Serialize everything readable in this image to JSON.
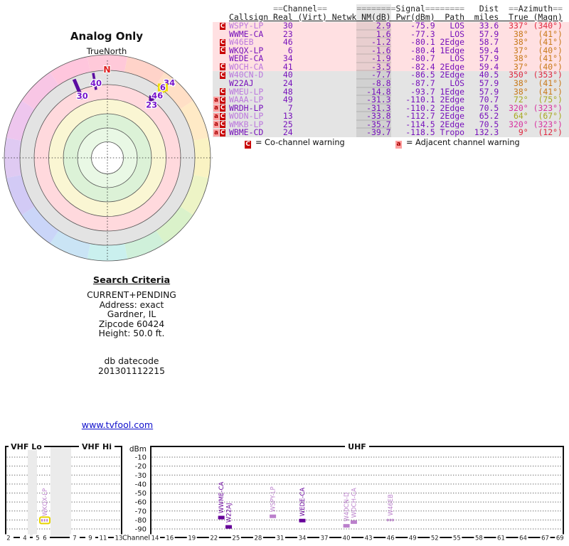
{
  "polar_chart": {
    "title": "Analog Only",
    "north_label": "TrueNorth",
    "compass_n": "N",
    "ring_colors": [
      "#FFC9D9",
      "#FFD3C9",
      "#FFDFC6",
      "#FFEAC6",
      "#FAF3C3",
      "#EDF4C6",
      "#DAF2CA",
      "#CFF0DA",
      "#CAF0EE",
      "#CAE4F5",
      "#CAD5F8",
      "#D2CAF5",
      "#DFCAF2",
      "#EEC6EE",
      "#F8C6E5",
      "#FFC6DD"
    ],
    "zone_colors": [
      "#E3E3E3",
      "#FFD9DD",
      "#FAF6D3",
      "#DCF2D7",
      "#E9F8E5",
      "#FFFFFF"
    ],
    "marks": [
      {
        "channel": "30",
        "azimuth_deg": 337,
        "r_inner": 90,
        "r_outer": 120,
        "thickness": 5
      },
      {
        "channel": "40",
        "azimuth_deg": 350.5,
        "r_inner": 97,
        "r_outer": 121,
        "thickness": 3.5
      }
    ],
    "arrow": {
      "azimuth_deg": 38,
      "from_radius": 124,
      "to_radius": 101
    },
    "labels": [
      {
        "text": "30",
        "azimuth_deg": 338,
        "radius": 94
      },
      {
        "text": "40",
        "azimuth_deg": 351.3,
        "radius": 106
      },
      {
        "text": "34",
        "azimuth_deg": 39.5,
        "radius": 137
      },
      {
        "text": "6",
        "azimuth_deg": 38.2,
        "radius": 126,
        "highlight": true
      },
      {
        "text": "46",
        "azimuth_deg": 38.8,
        "radius": 112
      },
      {
        "text": "23",
        "azimuth_deg": 39.8,
        "radius": 97
      }
    ]
  },
  "station_table": {
    "group_header_segments": [
      {
        "text": "         ",
        "tone": "dim"
      },
      {
        "text": "==",
        "tone": "dim"
      },
      {
        "text": "Channel",
        "tone": "word"
      },
      {
        "text": "==",
        "tone": "dim"
      },
      {
        "text": "      ",
        "tone": "dim"
      },
      {
        "text": "========",
        "tone": "dim"
      },
      {
        "text": "Signal",
        "tone": "word"
      },
      {
        "text": "========",
        "tone": "dim"
      },
      {
        "text": "   ",
        "tone": "dim"
      },
      {
        "text": "Dist",
        "tone": "word"
      },
      {
        "text": "  ",
        "tone": "dim"
      },
      {
        "text": "==",
        "tone": "dim"
      },
      {
        "text": "Azimuth",
        "tone": "word"
      },
      {
        "text": "==",
        "tone": "dim"
      }
    ],
    "column_header": "Callsign Real (Virt) Netwk NM(dB) Pwr(dBm)  Path  miles  True (Magn)",
    "rows": [
      {
        "warn": "C",
        "callsign": "WSPY-LP",
        "shade": "light",
        "real": "30",
        "nm": "2.9",
        "pwr": "-75.9",
        "path": "LOS",
        "miles": "33.6",
        "az_true": "337°",
        "az_magn": "(340°)",
        "az_color": "red",
        "bg": "pink"
      },
      {
        "warn": "",
        "callsign": "WWME-CA",
        "shade": "dark",
        "real": "23",
        "nm": "1.6",
        "pwr": "-77.3",
        "path": "LOS",
        "miles": "57.9",
        "az_true": "38°",
        "az_magn": "(41°)",
        "az_color": "orange",
        "bg": "pink"
      },
      {
        "warn": "C",
        "callsign": "W46EB",
        "shade": "light",
        "real": "46",
        "nm": "-1.2",
        "pwr": "-80.1",
        "path": "2Edge",
        "miles": "58.7",
        "az_true": "38°",
        "az_magn": "(41°)",
        "az_color": "orange",
        "bg": "pink"
      },
      {
        "warn": "C",
        "callsign": "WKQX-LP",
        "shade": "dark",
        "real": "6",
        "nm": "-1.6",
        "pwr": "-80.4",
        "path": "1Edge",
        "miles": "59.4",
        "az_true": "37°",
        "az_magn": "(40°)",
        "az_color": "orange",
        "bg": "pink"
      },
      {
        "warn": "",
        "callsign": "WEDE-CA",
        "shade": "dark",
        "real": "34",
        "nm": "-1.9",
        "pwr": "-80.7",
        "path": "LOS",
        "miles": "57.9",
        "az_true": "38°",
        "az_magn": "(41°)",
        "az_color": "orange",
        "bg": "pink"
      },
      {
        "warn": "C",
        "callsign": "WOCH-CA",
        "shade": "light",
        "real": "41",
        "nm": "-3.5",
        "pwr": "-82.4",
        "path": "2Edge",
        "miles": "59.4",
        "az_true": "37°",
        "az_magn": "(40°)",
        "az_color": "orange",
        "bg": "pink"
      },
      {
        "warn": "C",
        "callsign": "W40CN-D",
        "shade": "light",
        "real": "40",
        "nm": "-7.7",
        "pwr": "-86.5",
        "path": "2Edge",
        "miles": "40.5",
        "az_true": "350°",
        "az_magn": "(353°)",
        "az_color": "red",
        "bg": "gray"
      },
      {
        "warn": "",
        "callsign": "W22AJ",
        "shade": "dark",
        "real": "24",
        "nm": "-8.8",
        "pwr": "-87.7",
        "path": "LOS",
        "miles": "57.9",
        "az_true": "38°",
        "az_magn": "(41°)",
        "az_color": "orange",
        "bg": "gray"
      },
      {
        "warn": "C",
        "callsign": "WMEU-LP",
        "shade": "light",
        "real": "48",
        "nm": "-14.8",
        "pwr": "-93.7",
        "path": "1Edge",
        "miles": "57.9",
        "az_true": "38°",
        "az_magn": "(41°)",
        "az_color": "orange",
        "bg": "gray"
      },
      {
        "warn": "aC",
        "callsign": "WAAA-LP",
        "shade": "light",
        "real": "49",
        "nm": "-31.3",
        "pwr": "-110.1",
        "path": "2Edge",
        "miles": "70.7",
        "az_true": "72°",
        "az_magn": "(75°)",
        "az_color": "olive",
        "bg": "gray"
      },
      {
        "warn": "aC",
        "callsign": "WRDH-LP",
        "shade": "dark",
        "real": "7",
        "nm": "-31.3",
        "pwr": "-110.2",
        "path": "2Edge",
        "miles": "70.5",
        "az_true": "320°",
        "az_magn": "(323°)",
        "az_color": "magenta",
        "bg": "gray"
      },
      {
        "warn": "aC",
        "callsign": "WODN-LP",
        "shade": "light",
        "real": "13",
        "nm": "-33.8",
        "pwr": "-112.7",
        "path": "2Edge",
        "miles": "65.2",
        "az_true": "64°",
        "az_magn": "(67°)",
        "az_color": "olive",
        "bg": "gray"
      },
      {
        "warn": "aC",
        "callsign": "WMKB-LP",
        "shade": "light",
        "real": "25",
        "nm": "-35.7",
        "pwr": "-114.5",
        "path": "2Edge",
        "miles": "70.5",
        "az_true": "320°",
        "az_magn": "(323°)",
        "az_color": "magenta",
        "bg": "gray"
      },
      {
        "warn": "aC",
        "callsign": "WBME-CD",
        "shade": "dark",
        "real": "24",
        "nm": "-39.7",
        "pwr": "-118.5",
        "path": "Tropo",
        "miles": "132.3",
        "az_true": "9°",
        "az_magn": "(12°)",
        "az_color": "red",
        "bg": "gray"
      }
    ],
    "legend": [
      {
        "symbol": "C",
        "label": "= Co-channel warning"
      },
      {
        "symbol": "a",
        "label": "= Adjacent channel warning"
      }
    ]
  },
  "search_criteria": {
    "heading": "Search Criteria",
    "lines": [
      "CURRENT+PENDING",
      "Address: exact",
      "Gardner, IL",
      "Zipcode 60424",
      "Height: 50.0 ft."
    ],
    "db_label": "db datecode",
    "db_value": "201301112215"
  },
  "site_link": "www.tvfool.com",
  "spectrum_chart": {
    "y_axis_label": "dBm",
    "x_axis_label": "Channel",
    "y_ticks": [
      -10,
      -20,
      -30,
      -40,
      -50,
      -60,
      -70,
      -80,
      -90
    ],
    "bands": [
      {
        "label": "VHF Lo"
      },
      {
        "label": "VHF Hi"
      },
      {
        "label": "UHF"
      }
    ],
    "vhf_ticks": [
      2,
      4,
      5,
      6,
      7,
      9,
      11,
      13
    ],
    "uhf_ticks": [
      14,
      16,
      19,
      22,
      25,
      28,
      31,
      34,
      37,
      40,
      43,
      46,
      49,
      52,
      55,
      58,
      61,
      64,
      67,
      69
    ],
    "stations": [
      {
        "callsign": "WKQX-LP",
        "channel": 6,
        "dbm": -80.4,
        "shade": "light",
        "style": "dashed",
        "highlighted": true
      },
      {
        "callsign": "WWME-CA",
        "channel": 23,
        "dbm": -77.3,
        "shade": "dark",
        "style": "solid"
      },
      {
        "callsign": "W22AJ",
        "channel": 24,
        "dbm": -87.7,
        "shade": "dark",
        "style": "solid"
      },
      {
        "callsign": "WSPY-LP",
        "channel": 30,
        "dbm": -75.9,
        "shade": "light",
        "style": "solid"
      },
      {
        "callsign": "WEDE-CA",
        "channel": 34,
        "dbm": -80.7,
        "shade": "dark",
        "style": "solid"
      },
      {
        "callsign": "W40CN-D",
        "channel": 40,
        "dbm": -86.5,
        "shade": "light",
        "style": "solid"
      },
      {
        "callsign": "WOCH-CA",
        "channel": 41,
        "dbm": -82.4,
        "shade": "light",
        "style": "solid"
      },
      {
        "callsign": "W46EB",
        "channel": 46,
        "dbm": -80.1,
        "shade": "light",
        "style": "dashed"
      }
    ]
  },
  "chart_data": [
    {
      "type": "scatter",
      "title": "Analog Only (polar azimuth plot, TrueNorth up)",
      "points": [
        {
          "label": "30",
          "azimuth_deg": 337
        },
        {
          "label": "40",
          "azimuth_deg": 350
        },
        {
          "label": "34",
          "azimuth_deg": 38
        },
        {
          "label": "6",
          "azimuth_deg": 37
        },
        {
          "label": "46",
          "azimuth_deg": 38
        },
        {
          "label": "23",
          "azimuth_deg": 38
        }
      ],
      "legend_position": "none",
      "grid": true
    },
    {
      "type": "scatter",
      "title": "Signal power by TV channel",
      "xlabel": "Channel",
      "ylabel": "dBm",
      "ylim": [
        -95,
        -5
      ],
      "points": [
        {
          "callsign": "WKQX-LP",
          "x": 6,
          "y": -80.4
        },
        {
          "callsign": "WWME-CA",
          "x": 23,
          "y": -77.3
        },
        {
          "callsign": "W22AJ",
          "x": 24,
          "y": -87.7
        },
        {
          "callsign": "WSPY-LP",
          "x": 30,
          "y": -75.9
        },
        {
          "callsign": "WEDE-CA",
          "x": 34,
          "y": -80.7
        },
        {
          "callsign": "W40CN-D",
          "x": 40,
          "y": -86.5
        },
        {
          "callsign": "WOCH-CA",
          "x": 41,
          "y": -82.4
        },
        {
          "callsign": "W46EB",
          "x": 46,
          "y": -80.1
        }
      ],
      "grid": true
    }
  ],
  "colors": {
    "value_purple": "#7711BB",
    "callsign_light": "#BB77DD",
    "az_red": "#E02840",
    "az_orange": "#C87818",
    "az_olive": "#A8A820",
    "az_magenta": "#D832A0",
    "warn_c_bg": "#C80000",
    "warn_a_bg": "#FFA0A0",
    "warn_a_fg": "#A80000",
    "link_blue": "#1111CC",
    "marker_dark": "#660099",
    "marker_light": "#BB80CC",
    "highlight_yellow": "#E6D400",
    "row_pink": "#FFE0E2",
    "row_gray": "#E4E4E4",
    "mark_purple": "#5A0AA0"
  }
}
